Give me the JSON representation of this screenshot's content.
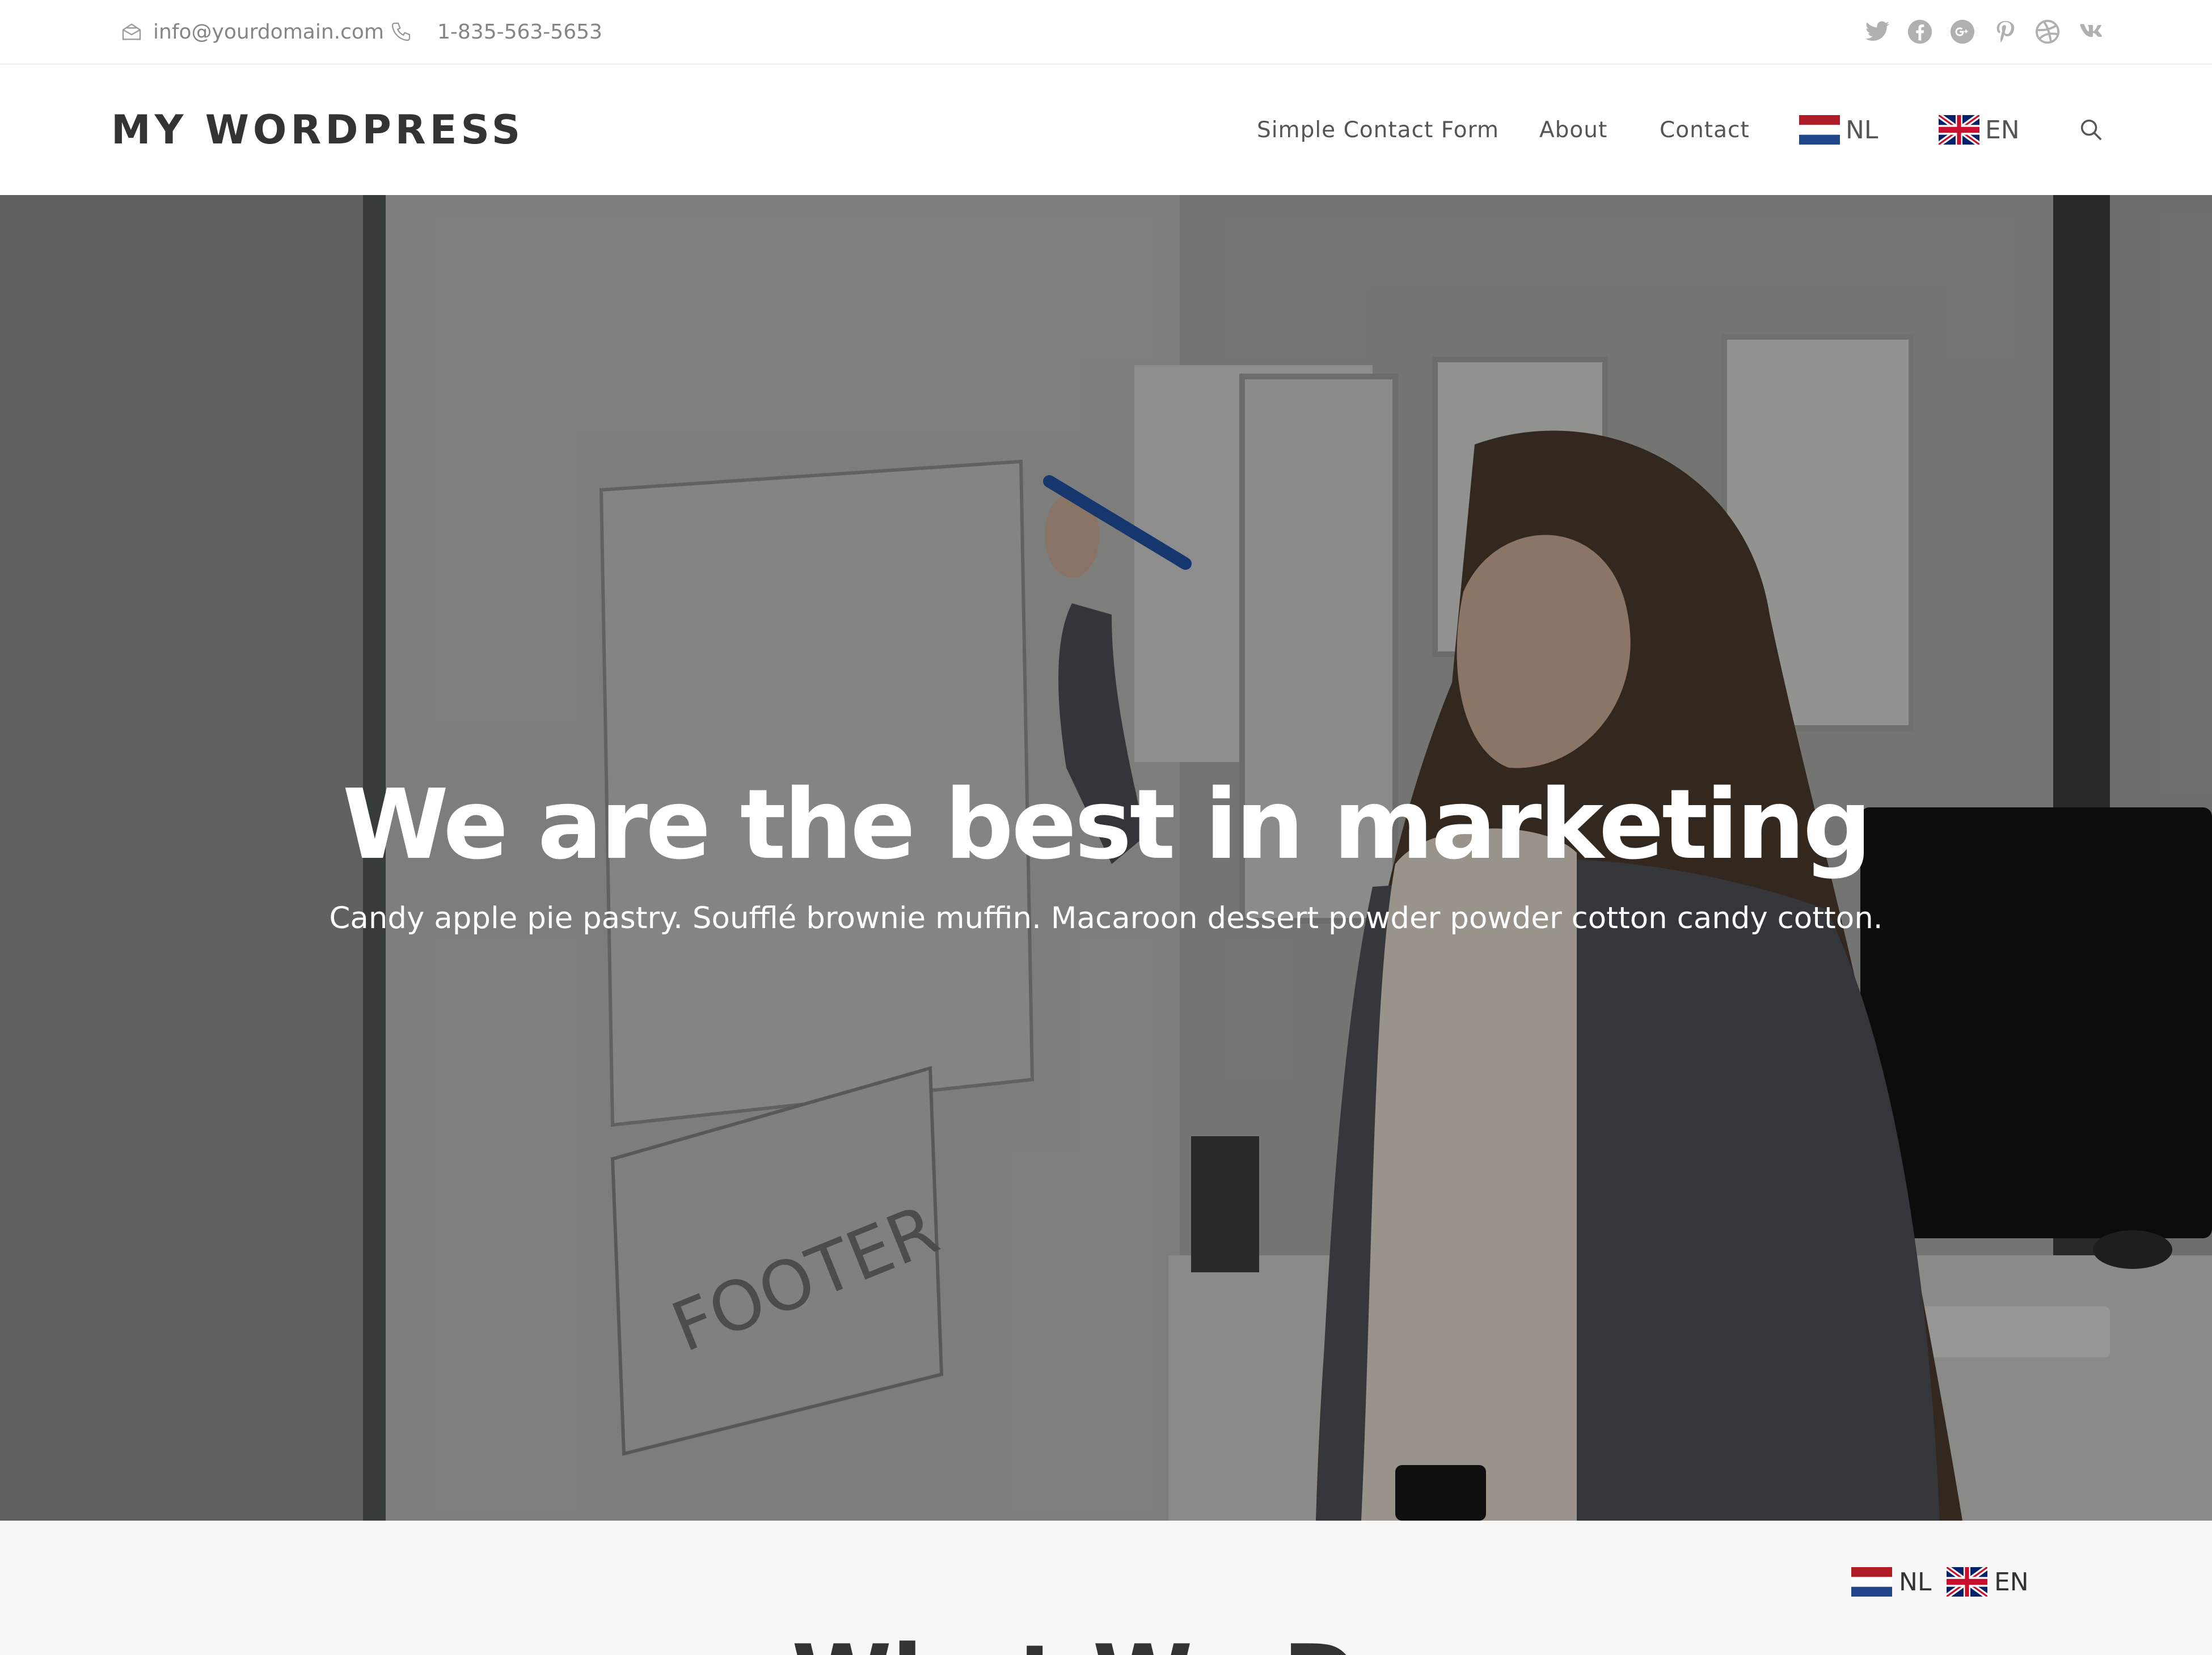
{
  "topbar": {
    "email": "info@yourdomain.com",
    "phone": "1-835-563-5653",
    "email_icon": "envelope-icon",
    "phone_icon": "phone-icon",
    "social_icons": [
      "twitter-icon",
      "facebook-icon",
      "google-plus-icon",
      "pinterest-icon",
      "dribbble-icon",
      "vk-icon"
    ]
  },
  "header": {
    "logo": "MY WORDPRESS",
    "nav": {
      "simple_contact_form": "Simple Contact Form",
      "about": "About",
      "contact": "Contact",
      "lang_nl": "NL",
      "lang_en": "EN"
    },
    "search_icon": "search-icon"
  },
  "hero": {
    "heading": "We are the best in marketing",
    "subtext": "Candy apple pie pastry. Soufflé brownie muffin. Macaroon dessert powder powder cotton candy cotton."
  },
  "lower": {
    "heading_partial": "What We Do",
    "lang_nl": "NL",
    "lang_en": "EN"
  },
  "colors": {
    "text_dark": "#333333",
    "text_muted": "#858585",
    "icon_muted": "#b0b0b0",
    "section_bg": "#f7f7f7"
  }
}
